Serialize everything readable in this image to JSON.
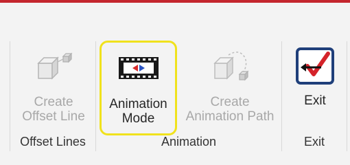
{
  "ribbon": {
    "accent_color": "#c4262e",
    "groups": [
      {
        "label": "Offset Lines",
        "buttons": [
          {
            "label_line1": "Create",
            "label_line2": "Offset Line",
            "icon": "offset-line-icon",
            "state": "disabled"
          }
        ]
      },
      {
        "label": "Animation",
        "buttons": [
          {
            "label_line1": "Animation",
            "label_line2": "Mode",
            "icon": "film-strip-icon",
            "state": "enabled",
            "highlighted": true
          },
          {
            "label_line1": "Create",
            "label_line2": "Animation Path",
            "icon": "animation-path-icon",
            "state": "disabled"
          }
        ]
      },
      {
        "label": "Exit",
        "buttons": [
          {
            "label_line1": "Exit",
            "icon": "exit-checkmark-icon",
            "state": "enabled"
          }
        ]
      }
    ]
  }
}
